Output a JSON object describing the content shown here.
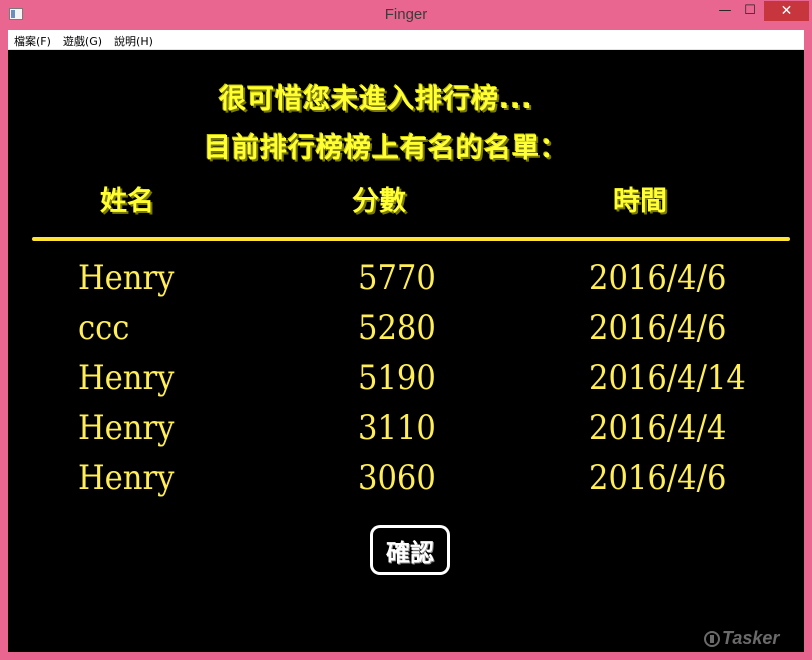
{
  "window": {
    "title": "Finger",
    "min_label": "—",
    "max_label": "☐",
    "close_label": "✕"
  },
  "menu": [
    {
      "label": "檔案(F)"
    },
    {
      "label": "遊戲(G)"
    },
    {
      "label": "說明(H)"
    }
  ],
  "message": {
    "line1": "很可惜您未進入排行榜...",
    "line2": "目前排行榜榜上有名的名單："
  },
  "table": {
    "columns": [
      "姓名",
      "分數",
      "時間"
    ],
    "rows": [
      {
        "name": "Henry",
        "score": "5770",
        "time": "2016/4/6"
      },
      {
        "name": "ccc",
        "score": "5280",
        "time": "2016/4/6"
      },
      {
        "name": "Henry",
        "score": "5190",
        "time": "2016/4/14"
      },
      {
        "name": "Henry",
        "score": "3110",
        "time": "2016/4/4"
      },
      {
        "name": "Henry",
        "score": "3060",
        "time": "2016/4/6"
      }
    ]
  },
  "confirm_label": "確認",
  "watermark": "Tasker",
  "colors": {
    "frame": "#e8668f",
    "background": "#000000",
    "accent": "#ffff33",
    "row_text": "#ffee55"
  }
}
